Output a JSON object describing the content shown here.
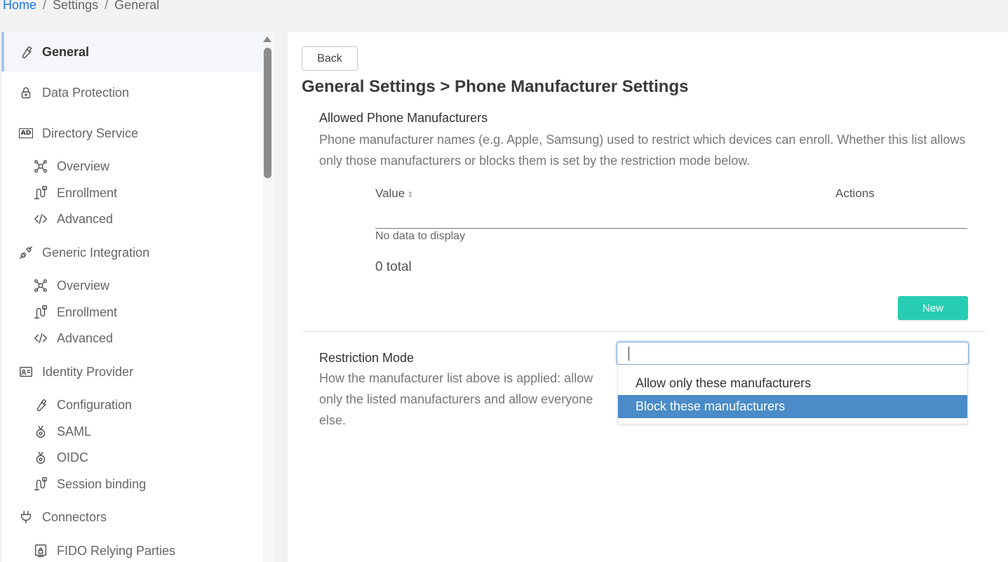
{
  "breadcrumb": {
    "home": "Home",
    "settings": "Settings",
    "current": "General",
    "separator": "/"
  },
  "sidebar": {
    "items": [
      {
        "label": "General",
        "icon": "wrench-icon"
      },
      {
        "label": "Data Protection",
        "icon": "lock-icon"
      },
      {
        "label": "Directory Service",
        "icon": "ad-icon"
      },
      {
        "label": "Overview",
        "icon": "overview-icon"
      },
      {
        "label": "Enrollment",
        "icon": "enrollment-icon"
      },
      {
        "label": "Advanced",
        "icon": "code-icon"
      },
      {
        "label": "Generic Integration",
        "icon": "plug-connect-icon"
      },
      {
        "label": "Overview",
        "icon": "overview-icon"
      },
      {
        "label": "Enrollment",
        "icon": "enrollment-icon"
      },
      {
        "label": "Advanced",
        "icon": "code-icon"
      },
      {
        "label": "Identity Provider",
        "icon": "id-card-icon"
      },
      {
        "label": "Configuration",
        "icon": "wrench-icon"
      },
      {
        "label": "SAML",
        "icon": "saml-icon"
      },
      {
        "label": "OIDC",
        "icon": "oidc-icon"
      },
      {
        "label": "Session binding",
        "icon": "enrollment-icon"
      },
      {
        "label": "Connectors",
        "icon": "plug-icon"
      },
      {
        "label": "FIDO Relying Parties",
        "icon": "fido-icon"
      }
    ]
  },
  "main": {
    "back_label": "Back",
    "title": "General Settings > Phone Manufacturer Settings",
    "manufacturers": {
      "title": "Allowed Phone Manufacturers",
      "description": "Phone manufacturer names (e.g. Apple, Samsung) used to restrict which devices can enroll. Whether this list allows only those manufacturers or blocks them is set by the restriction mode below.",
      "columns": {
        "value": "Value",
        "actions": "Actions"
      },
      "empty_text": "No data to display",
      "total_text": "0 total",
      "new_label": "New"
    },
    "restriction": {
      "title": "Restriction Mode",
      "description": "How the manufacturer list above is applied: allow only the listed manufacturers and allow everyone else.",
      "input_value": "",
      "options": [
        "Allow only these manufacturers",
        "Block these manufacturers"
      ],
      "highlighted_option": "Block these manufacturers"
    }
  },
  "colors": {
    "accent_link": "#1a73e8",
    "new_button": "#27cdb2",
    "option_highlight": "#4a8bc8"
  }
}
